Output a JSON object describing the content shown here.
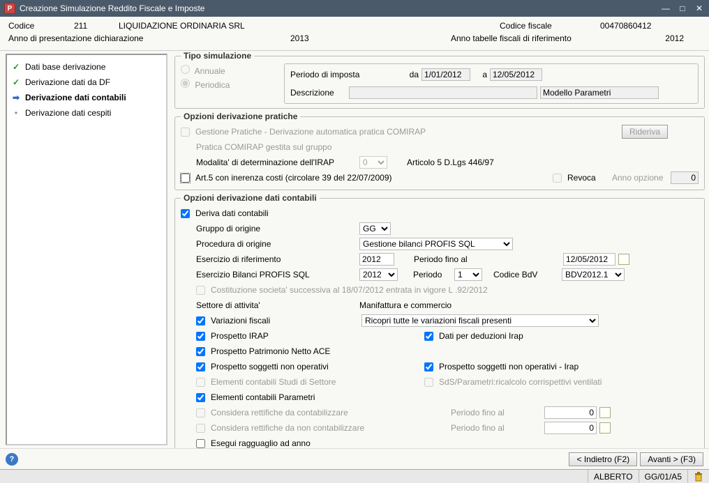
{
  "window": {
    "title": "Creazione Simulazione Reddito Fiscale e Imposte"
  },
  "header": {
    "codice_label": "Codice",
    "codice_val": "211",
    "company": "LIQUIDAZIONE ORDINARIA SRL",
    "cfiscale_label": "Codice fiscale",
    "cfiscale_val": "00470860412",
    "anno_pres_label": "Anno di presentazione dichiarazione",
    "anno_pres_val": "2013",
    "anno_tab_label": "Anno tabelle fiscali di riferimento",
    "anno_tab_val": "2012"
  },
  "nav": {
    "items": [
      "Dati base derivazione",
      "Derivazione dati da DF",
      "Derivazione dati contabili",
      "Derivazione dati cespiti"
    ]
  },
  "tipo": {
    "legend": "Tipo simulazione",
    "annuale": "Annuale",
    "periodica": "Periodica",
    "periodo_imposta": "Periodo di imposta",
    "da": "da",
    "da_val": "1/01/2012",
    "a": "a",
    "a_val": "12/05/2012",
    "descrizione": "Descrizione",
    "descrizione_val": "",
    "modello": "Modello Parametri"
  },
  "pratiche": {
    "legend": "Opzioni derivazione pratiche",
    "gestione": "Gestione Pratiche - Derivazione automatica pratica COMIRAP",
    "rideriva": "Rideriva",
    "gruppo": "Pratica COMIRAP gestita sul gruppo",
    "modalita": "Modalita' di determinazione dell'IRAP",
    "modalita_val": "0",
    "articolo": "Articolo 5 D.Lgs 446/97",
    "art5": "Art.5 con inerenza costi (circolare 39 del 22/07/2009)",
    "revoca": "Revoca",
    "anno_opzione": "Anno opzione",
    "anno_opzione_val": "0"
  },
  "contabili": {
    "legend": "Opzioni derivazione dati contabili",
    "deriva": "Deriva dati contabili",
    "gruppo_origine": "Gruppo di origine",
    "gruppo_origine_val": "GG",
    "procedura": "Procedura di origine",
    "procedura_val": "Gestione bilanci PROFIS SQL",
    "esercizio_rif": "Esercizio di riferimento",
    "esercizio_rif_val": "2012",
    "periodo_fino": "Periodo fino al",
    "periodo_fino_val": "12/05/2012",
    "esercizio_bil": "Esercizio Bilanci PROFIS SQL",
    "esercizio_bil_val": "2012",
    "periodo": "Periodo",
    "periodo_val": "1",
    "codice_bdv": "Codice BdV",
    "codice_bdv_val": "BDV2012.1",
    "costituzione": "Costituzione societa' successiva al 18/07/2012 entrata in vigore L .92/2012",
    "settore": "Settore di attivita'",
    "manifattura": "Manifattura e commercio",
    "variazioni": "Variazioni fiscali",
    "ricopri": "Ricopri tutte le variazioni fiscali presenti",
    "prospetto_irap": "Prospetto IRAP",
    "dati_deduzioni": "Dati per deduzioni Irap",
    "prospetto_ace": "Prospetto Patrimonio Netto ACE",
    "prospetto_non_op": "Prospetto soggetti non operativi",
    "prospetto_non_op_irap": "Prospetto soggetti non operativi - Irap",
    "studi": "Elementi contabili Studi di Settore",
    "sds": "SdS/Parametri:ricalcolo corrispettivi ventilati",
    "parametri": "Elementi contabili Parametri",
    "rett_cont": "Considera rettifiche da contabilizzare",
    "rett_non_cont": "Considera rettifiche da non contabilizzare",
    "periodo_fino_rett": "Periodo fino al",
    "zero_val": "0",
    "ragguaglio": "Esegui ragguaglio ad anno"
  },
  "footer": {
    "indietro": "< Indietro (F2)",
    "avanti": "Avanti > (F3)"
  },
  "status": {
    "user": "ALBERTO",
    "code": "GG/01/A5"
  }
}
